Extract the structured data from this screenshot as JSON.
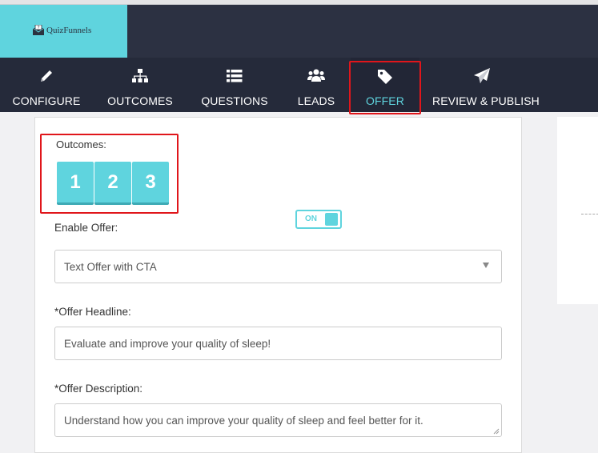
{
  "brand": {
    "name": "QuizFunnels",
    "logo_icon": "quiz-envelope-icon",
    "accent": "#5fd4de"
  },
  "nav": {
    "items": [
      {
        "label": "CONFIGURE",
        "icon": "pencil-icon"
      },
      {
        "label": "OUTCOMES",
        "icon": "sitemap-icon"
      },
      {
        "label": "QUESTIONS",
        "icon": "list-icon"
      },
      {
        "label": "LEADS",
        "icon": "users-icon"
      },
      {
        "label": "OFFER",
        "icon": "tag-icon",
        "active": true
      },
      {
        "label": "REVIEW & PUBLISH",
        "icon": "paper-plane-icon"
      }
    ]
  },
  "outcomes": {
    "label": "Outcomes:",
    "tabs": [
      "1",
      "2",
      "3"
    ]
  },
  "offer": {
    "toggle_label": "ON",
    "enable_label": "Enable Offer:",
    "type_value": "Text Offer with CTA",
    "headline_label": "*Offer Headline:",
    "headline_value": "Evaluate and improve your quality of sleep!",
    "description_label": "*Offer Description:",
    "description_value": "Understand how you can improve your quality of sleep and feel better for it."
  }
}
